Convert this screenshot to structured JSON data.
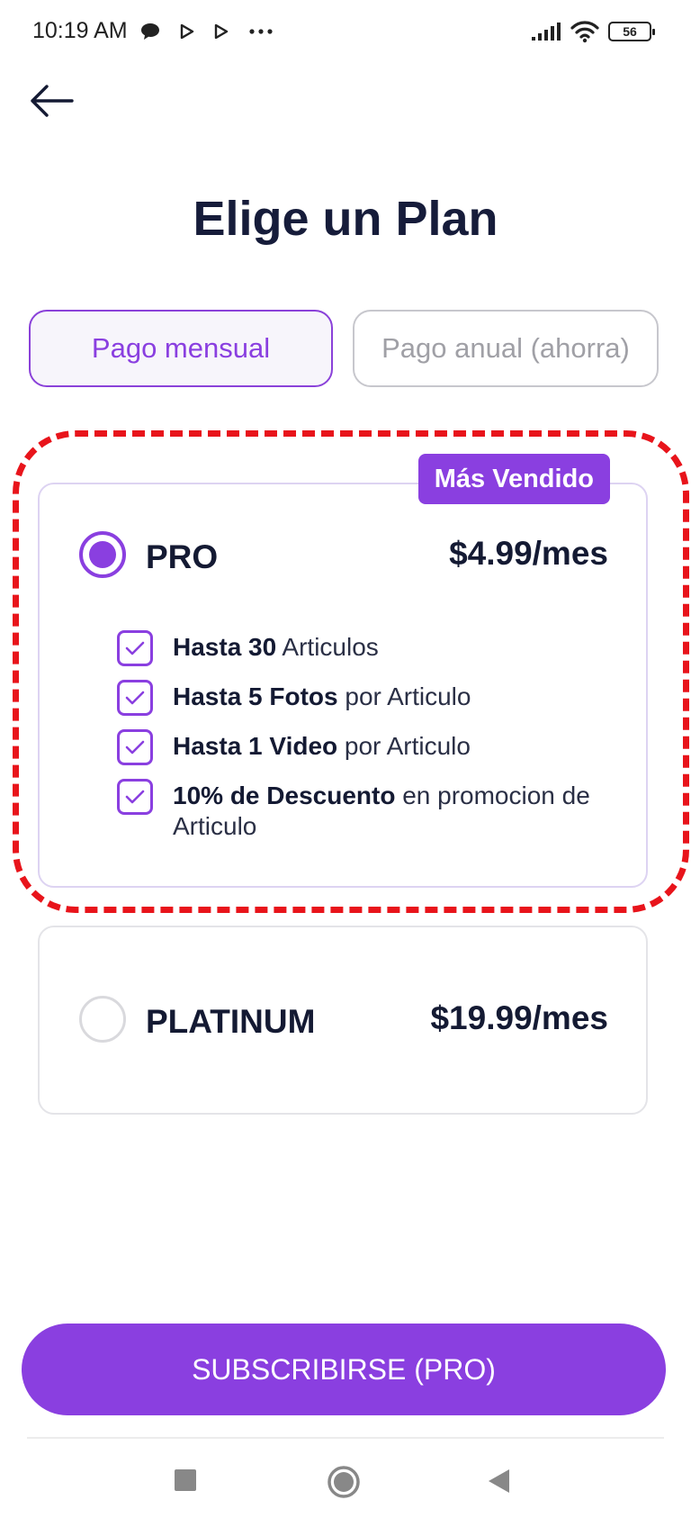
{
  "status_bar": {
    "time": "10:19 AM",
    "battery": "56"
  },
  "header": {
    "title": "Elige un Plan"
  },
  "billing_toggle": {
    "monthly_label": "Pago mensual",
    "annual_label": "Pago anual (ahorra)",
    "selected": "monthly"
  },
  "plans": [
    {
      "name": "PRO",
      "price": "$4.99/mes",
      "selected": true,
      "badge": "Más Vendido",
      "features": [
        {
          "bold": "Hasta 30",
          "rest": " Articulos"
        },
        {
          "bold": "Hasta 5 Fotos",
          "rest": " por Articulo"
        },
        {
          "bold": "Hasta 1 Video",
          "rest": " por Articulo"
        },
        {
          "bold": "10% de Descuento",
          "rest": " en promocion de Articulo"
        }
      ]
    },
    {
      "name": "PLATINUM",
      "price": "$19.99/mes",
      "selected": false
    }
  ],
  "subscribe_button": {
    "label": "SUBSCRIBIRSE (PRO)"
  },
  "colors": {
    "accent": "#8a3fe0",
    "title": "#161c3a",
    "highlight": "#e8141b"
  }
}
